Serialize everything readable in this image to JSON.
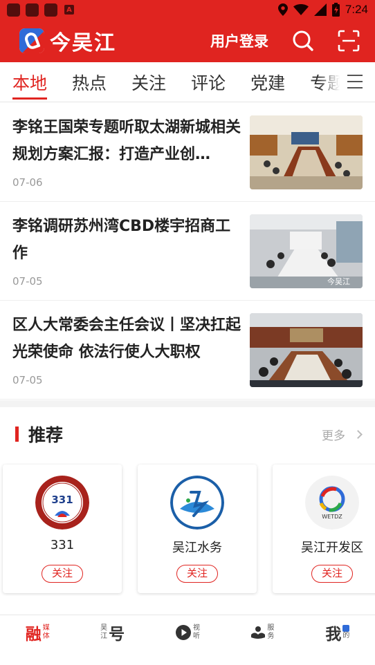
{
  "status_bar": {
    "time": "7:24",
    "app_badge": "A"
  },
  "header": {
    "logo_text": "今吴江",
    "login_label": "用户登录"
  },
  "tabs": [
    {
      "label": "本地",
      "active": true
    },
    {
      "label": "热点",
      "active": false
    },
    {
      "label": "关注",
      "active": false
    },
    {
      "label": "评论",
      "active": false
    },
    {
      "label": "党建",
      "active": false
    },
    {
      "label": "专题",
      "active": false
    }
  ],
  "news": [
    {
      "title": "李铭王国荣专题听取太湖新城相关规划方案汇报：打造产业创…",
      "date": "07-06"
    },
    {
      "title": "李铭调研苏州湾CBD楼宇招商工作",
      "date": "07-05",
      "watermark": "今吴江"
    },
    {
      "title": "区人大常委会主任会议丨坚决扛起光荣使命 依法行使人大职权",
      "date": "07-05"
    }
  ],
  "recommend": {
    "title": "推荐",
    "more_label": "更多",
    "cards": [
      {
        "name": "331",
        "logo_text": "331",
        "follow_label": "关注"
      },
      {
        "name": "吴江水务",
        "logo_text": "吴江水务",
        "follow_label": "关注"
      },
      {
        "name": "吴江开发区",
        "logo_text": "WETDZ",
        "follow_label": "关注"
      }
    ]
  },
  "bottom_nav": {
    "items": [
      {
        "big": "融",
        "small": [
          "媒",
          "体"
        ],
        "active": true
      },
      {
        "big": "号",
        "small": [
          "吴",
          "江"
        ],
        "active": false
      },
      {
        "big": "",
        "small": [
          "视",
          "听"
        ],
        "active": false
      },
      {
        "big": "",
        "small": [
          "服",
          "务"
        ],
        "active": false
      },
      {
        "big": "我",
        "small": [
          "",
          "的"
        ],
        "active": false
      }
    ]
  },
  "colors": {
    "brand_red": "#e02420",
    "text_dark": "#222222",
    "text_muted": "#999999"
  }
}
